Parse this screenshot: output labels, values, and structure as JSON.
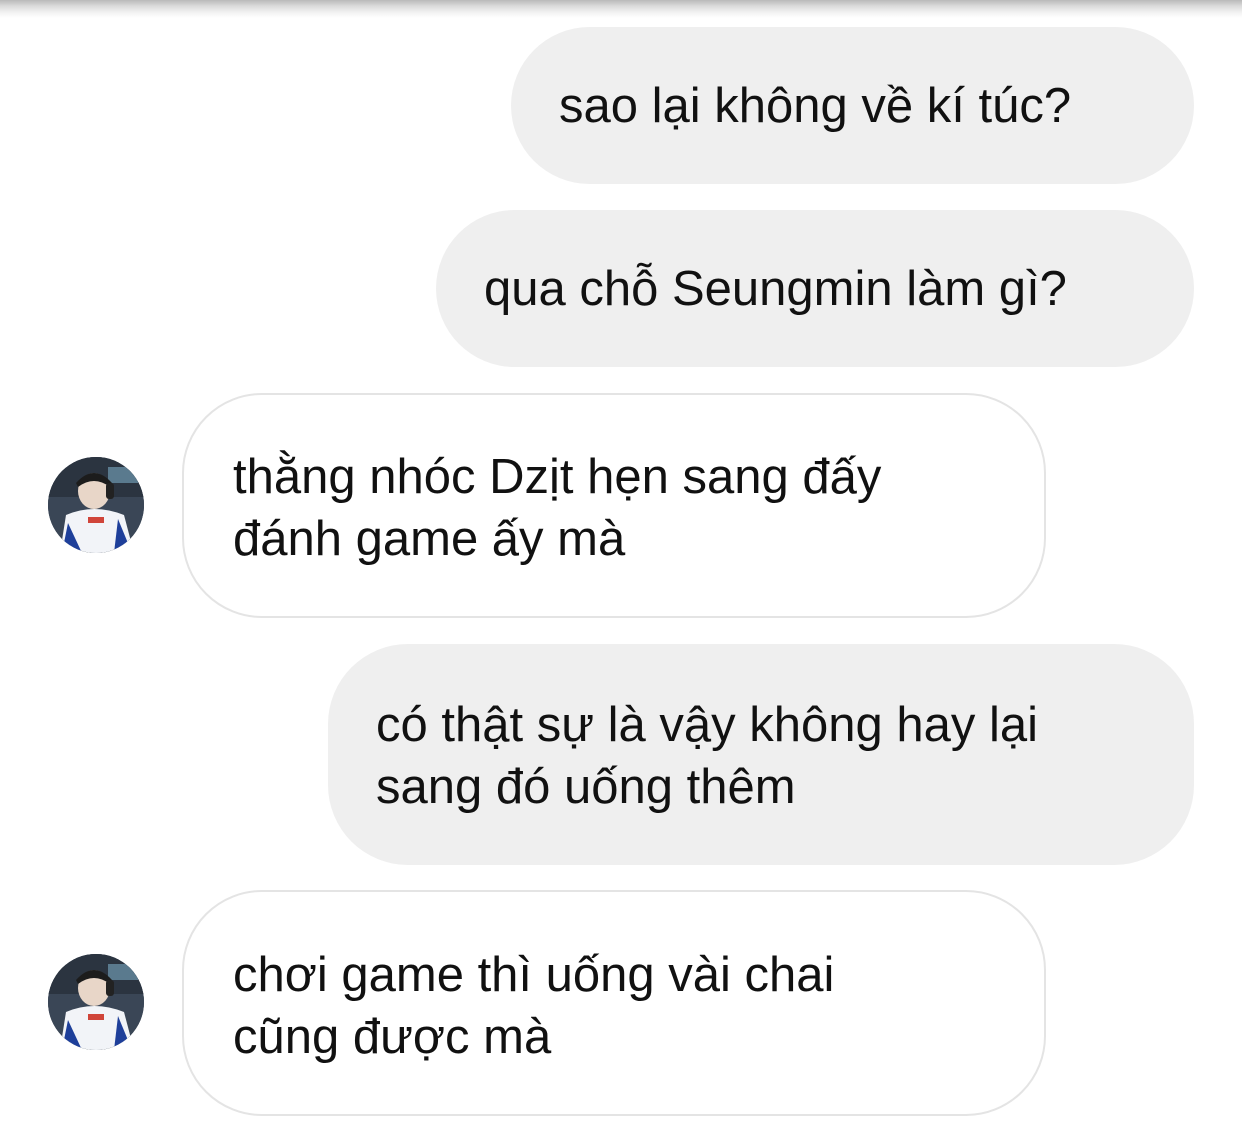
{
  "conversation": {
    "messages": [
      {
        "direction": "outgoing",
        "lines": [
          "sao lại không về kí túc?"
        ]
      },
      {
        "direction": "outgoing",
        "lines": [
          "qua chỗ Seungmin làm gì?"
        ]
      },
      {
        "direction": "incoming",
        "lines": [
          "thằng nhóc Dzịt hẹn sang đấy",
          "đánh game ấy mà"
        ]
      },
      {
        "direction": "outgoing",
        "lines": [
          "có thật sự là vậy không hay lại",
          "sang đó uống thêm"
        ]
      },
      {
        "direction": "incoming",
        "lines": [
          "chơi game thì uống vài chai",
          "cũng được mà"
        ]
      }
    ]
  },
  "colors": {
    "outgoing_bubble": "#efefef",
    "incoming_bubble": "#ffffff",
    "incoming_border": "#e4e4e4",
    "text": "#111111"
  },
  "icons": {
    "avatar": "contact-avatar-photo"
  }
}
